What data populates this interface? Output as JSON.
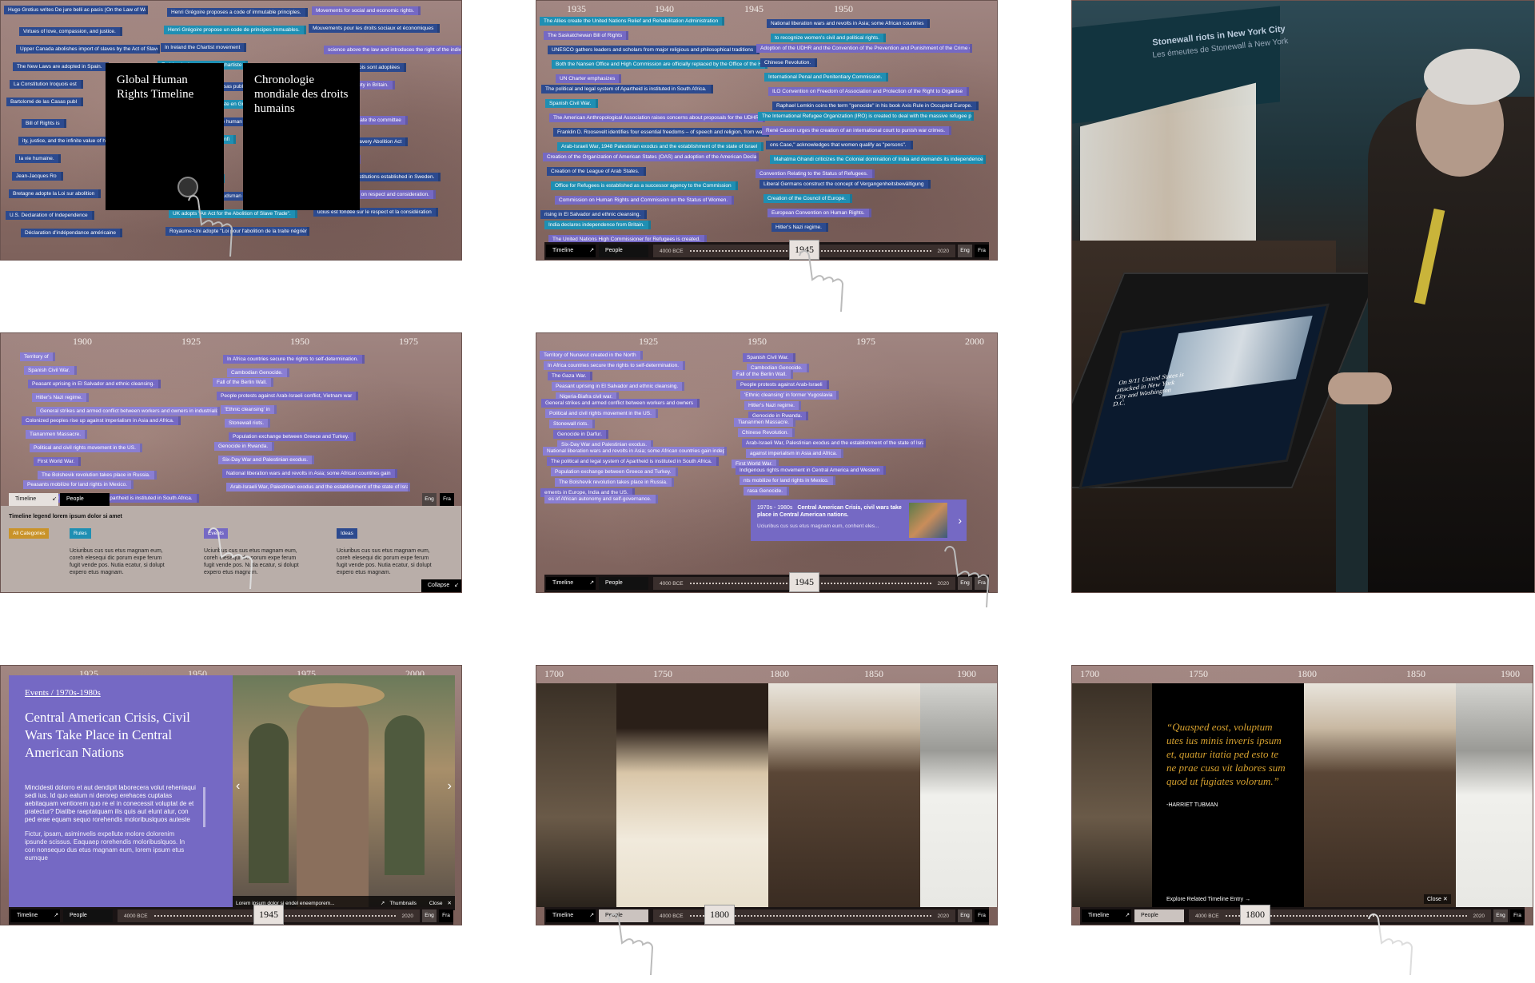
{
  "p1": {
    "card_en": "Global Human Rights Timeline",
    "card_fr": "Chronologie mondiale des droits humains",
    "tags": [
      "Hugo Grotius writes De jure belli ac pacis (On the Law of War and Peace)",
      "Henri Grégoire proposes a code of immutable principles.",
      "Movements for social and economic rights.",
      "Virtues of love, compassion, and justice.",
      "Henri Grégoire propose un code de principes immuables.",
      "Mouvements pour les droits sociaux et économiques",
      "Upper Canada abolishes import of slaves by the Act of Slavery.",
      "In Ireland the Chartist movement",
      "science above the law and introduces the right of the individual.",
      "The New Laws are adopted in Spain.",
      "En Irlande, le mouvement chartiste",
      "Les nouvelles lois sont adoptées",
      "La Constitution Iroquois est",
      "Bartolomé de las Casas publ",
      "Antislavery Society in Britain.",
      "Bartolomé de las Casas publ",
      "Société antiesclavagiste en Grande",
      "Bill of Rights is",
      "Bill of Rights is",
      "Averroes writes that the human",
      "and Vienna and create the committee",
      "ity, justice, and the infinite value of human",
      "sponsabilité, à la valeur infi",
      "Britain passes the Slavery Abolition Act",
      "la vie humaine.",
      "Athens.",
      "Spanish Co",
      "Jean-Jacques Ro",
      "Jean-Jacques Rousseau",
      "Ombudsman institutions established in Sweden.",
      "Bretagne adopte la Loi sur abolition",
      "Institutions de l'Ombudsman établie en Suède.",
      "fucius is founded on respect and consideration.",
      "U.S. Declaration of Independence",
      "UK adopts \"An Act for the Abolition of Slave Trade\".",
      "ucius est fondée sur le respect et la considération",
      "Déclaration d'indépendance américaine",
      "Royaume-Uni adopte \"Loi pour l'abolition de la traite négrière\"."
    ]
  },
  "p2": {
    "years": [
      "1935",
      "1940",
      "1945",
      "1950"
    ],
    "tags": [
      "The Allies create the United Nations Relief and Rehabilitation Administration",
      "National liberation wars and revolts in Asia; some African countries",
      "The Saskatchewan Bill of Rights",
      "to recognize women's civil and political rights.",
      "UNESCO gathers leaders and scholars from major religious and philosophical traditions",
      "Adoption of the UDHR and the Convention of the Prevention and Punishment of the Crime of Genocide.",
      "Both the Nansen Office and High Commission are officially replaced by the Office of the High Commissioner for Refugees.",
      "Chinese Revolution.",
      "UN Charter emphasizes",
      "International Penal and Penitentiary Commission.",
      "The political and legal system of Apartheid is instituted in South Africa.",
      "ILO Convention on Freedom of Association and Protection of the Right to Organise",
      "Spanish Civil War.",
      "Raphael Lemkin coins the term \"genocide\" in his book Axis Rule in Occupied Europe.",
      "The American Anthropological Association raises concerns about proposals for the UDHR.",
      "The International Refugee Organization (IRO) is created to deal with the massive refugee problem",
      "Franklin D. Roosevelt identifies four essential freedoms – of speech and religion, from want and fear.",
      "René Cassin urges the creation of an international court to punish war crimes.",
      "Arab-Israeli War, 1948 Palestinian exodus and the establishment of the state of Israel",
      "ons Case,\" acknowledges that women qualify as \"persons\".",
      "Creation of the Organization of American States (OAS) and adoption of the American Declaration",
      "Mahatma Ghandi criticizes the Colonial domination of India and demands its independence",
      "Creation of the League of Arab States.",
      "Convention Relating to the Status of Refugees.",
      "Office for Refugees is established as a successor agency to the Commission",
      "Liberal Germans construct the concept of Vergangenheitsbewältigung",
      "Commission on Human Rights and Commission on the Status of Women.",
      "Creation of the Council of Europe.",
      "rising in El Salvador and ethnic cleansing.",
      "European Convention on Human Rights.",
      "India declares independence from Britain.",
      "Hitler's Nazi regime.",
      "The United Nations High Commissioner for Refugees is created."
    ]
  },
  "p4": {
    "years": [
      "1900",
      "1925",
      "1950",
      "1975"
    ],
    "tags": [
      "Territory of",
      "In Africa countries secure the rights to self-determination.",
      "Spanish Civil War.",
      "Cambodian Genocide.",
      "Peasant uprising in El Salvador and ethnic cleansing.",
      "Fall of the Berlin Wall.",
      "Hitler's Nazi regime.",
      "People protests against Arab-Israeli conflict, Vietnam war",
      "General strikes and armed conflict between workers and owners in industrialized world.",
      "'Ethnic cleansing' in",
      "Colonized peoples rise up against imperialism in Asia and Africa.",
      "Stonewall riots.",
      "Tiananmen Massacre.",
      "Population exchange between Greece and Turkey.",
      "Political and civil rights movement in the US.",
      "Genocide in Rwanda.",
      "First World War.",
      "Six-Day War and Palestinian exodus.",
      "The Bolshevik revolution takes place in Russia.",
      "National liberation wars and revolts in Asia; some African countries gain",
      "Peasants mobilize for land rights in Mexico.",
      "Arab-Israeli War, Palestinian exodus and the establishment of the state of Israel",
      "The political and legal system of Apartheid is instituted in South Africa."
    ],
    "legend": {
      "title": "Timeline legend lorem ipsum dolor si amet",
      "cats": [
        "All Categories",
        "Rules",
        "Events",
        "Ideas"
      ],
      "text": "Uciuribus cus sus etus magnam eum, coreh elesequi dic porum expe ferum fugit vende pos. Nutia ecatur, si dolupt expero etus magnam."
    },
    "tabs": {
      "timeline": "Timeline",
      "people": "People",
      "collapse": "Collapse"
    }
  },
  "p5": {
    "years": [
      "1925",
      "1950",
      "1975",
      "2000"
    ],
    "tags": [
      "Territory of Nunavut created in the North",
      "Spanish Civil War.",
      "In Africa countries secure the rights to self-determination.",
      "Cambodian Genocide.",
      "The Gaza War.",
      "Fall of the Berlin Wall.",
      "Peasant uprising in El Salvador and ethnic cleansing.",
      "People protests against Arab-Israeli",
      "Nigeria-Biafra civil war.",
      "'Ethnic cleansing' in former Yugoslavia",
      "General strikes and armed conflict between workers and owners",
      "Hitler's Nazi regime.",
      "Political and civil rights movement in the US.",
      "Genocide in Rwanda.",
      "Stonewall riots.",
      "Tiananmen Massacre.",
      "Genocide in Darfur.",
      "Chinese Revolution.",
      "Six-Day War and Palestinian exodus.",
      "Arab-Israeli War, Palestinian exodus and the establishment of the state of Israel",
      "National liberation wars and revolts in Asia; some African countries gain independence.",
      "against imperialism in Asia and Africa.",
      "The political and legal system of Apartheid is instituted in South Africa.",
      "First World War.",
      "Population exchange between Greece and Turkey.",
      "Indigenous rights movement in Central America and Western",
      "The Bolshevik revolution takes place in Russia.",
      "nts mobilize for land rights in Mexico.",
      "ements in Europe, India and the US.",
      "rasa Genocide.",
      "es of African autonomy and self-governance."
    ],
    "popup": {
      "range": "1970s - 1980s",
      "title": "Central American Crisis, civil wars take place in Central American nations.",
      "body": "Uciuribus cus sus etus magnam eum, conhent eles..."
    }
  },
  "p7": {
    "years": [
      "1925",
      "1950",
      "1975",
      "2000"
    ],
    "crumb": "Events / 1970s-1980s",
    "title": "Central American Crisis, Civil Wars Take Place in Central American Nations",
    "body1": "Mincidesti dolorro et aut dendipit laborecera volut reheniaqui sedi ius. Id quo eatum ni derorep erehaces cuptatas aebitaquam ventiorem quo re el in conecessit voluptat de et pratectur? Diatibe raeptatquam ilis quis aut elunt atur, con ped erae equam sequo rorehendis moloribuslquos auteste",
    "body2": "Fictur, ipsam, asiminvelis expellute molore dolorenim ipsunde scissus. Eaquaep rorehendis moloribuslquos. In con nonsequo dus etus magnam eum, lorem ipsum etus eumque",
    "caption": "Lorem ipsum dolor si endel eneemporem...",
    "thumbnails": "Thumbnails",
    "close": "Close"
  },
  "p8": {
    "years": [
      "1700",
      "1750",
      "1800",
      "1850",
      "1900"
    ]
  },
  "p9": {
    "years": [
      "1700",
      "1750",
      "1800",
      "1850",
      "1900"
    ],
    "quote": "“Quasped eost, voluptum utes ius minis inveris ipsum et, quatur itatia ped esto te ne prae cusa vit labores sum quod ut fugiates volorum.”",
    "attribution": "-HARRIET TUBMAN",
    "related": "Explore Related Timeline Entry",
    "close": "Close"
  },
  "bars": {
    "timeline": "Timeline",
    "people": "People",
    "start": "4000 BCE",
    "end": "2020",
    "eng": "Eng",
    "fra": "Fra",
    "year_1945": "1945",
    "year_1800": "1800"
  },
  "photo": {
    "screen_heading": "On 9/11 United States is attacked in New York City and Washington D.C.",
    "banner": "Stonewall riots in New York City",
    "banner_fr": "Les émeutes de Stonewall à New York"
  }
}
